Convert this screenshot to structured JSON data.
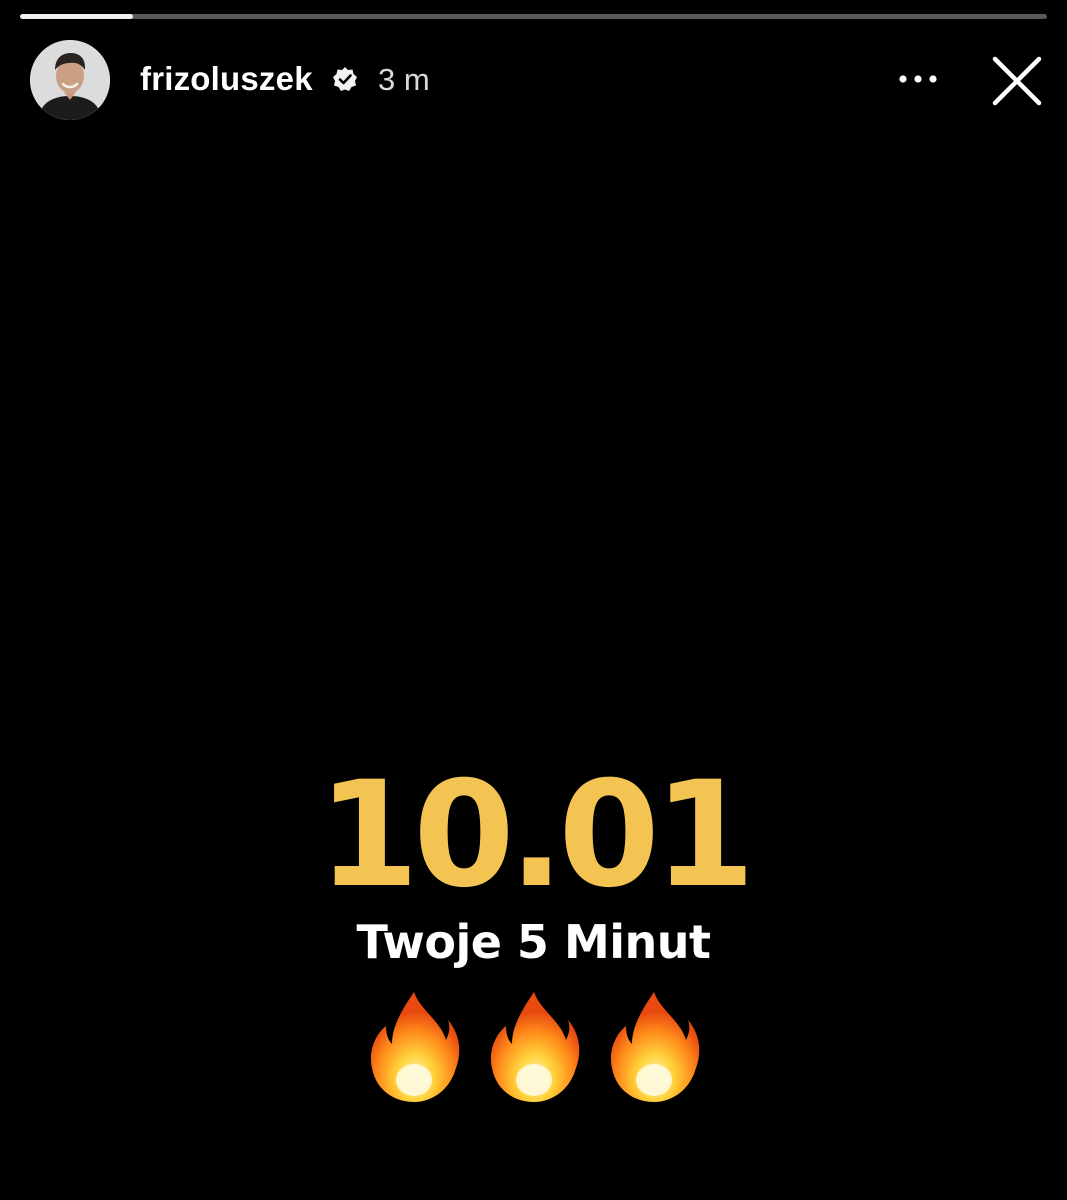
{
  "story": {
    "progress": 0.11,
    "progress_fill_color": "#f2f2f2",
    "username": "frizoluszek",
    "verified": true,
    "time_ago": "3 m",
    "menu_icon": "more-horizontal-icon",
    "close_icon": "close-icon",
    "avatar_icon": "avatar"
  },
  "content": {
    "big_text": "10.01",
    "big_text_color": "#f3c451",
    "subtitle": "Twoje 5 Minut",
    "emojis": [
      "fire-icon",
      "fire-icon",
      "fire-icon"
    ]
  }
}
